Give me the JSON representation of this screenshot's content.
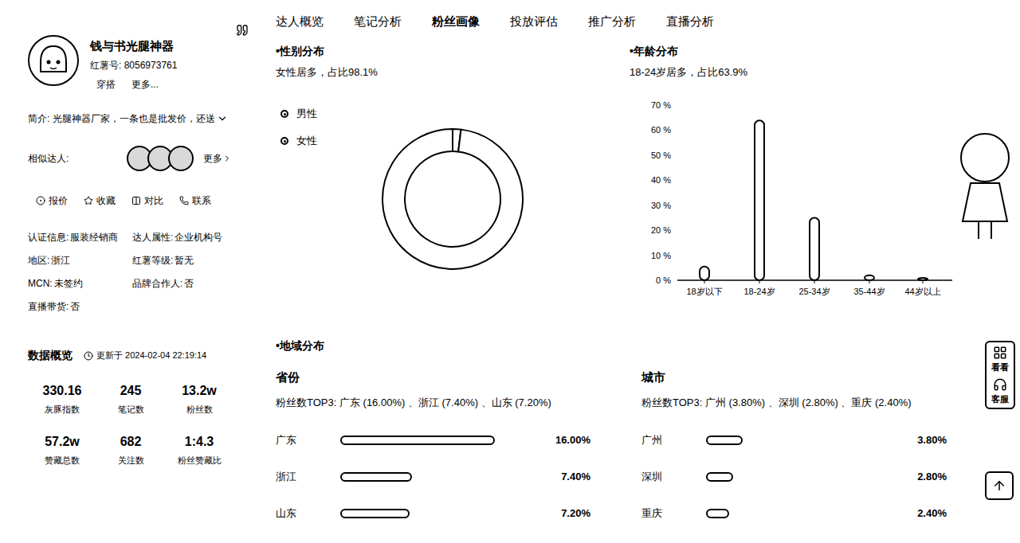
{
  "profile": {
    "name": "钱与书光腿神器",
    "red_id": "红薯号: 8056973761",
    "tags": [
      "穿搭",
      "更多..."
    ],
    "intro": "简介: 光腿神器厂家，一条也是批发价，还送",
    "similar_label": "相似达人:",
    "similar_more": "更多"
  },
  "actions": [
    {
      "label": "报价"
    },
    {
      "label": "收藏"
    },
    {
      "label": "对比"
    },
    {
      "label": "联系"
    }
  ],
  "info": [
    {
      "label": "认证信息:",
      "value": "服装经销商"
    },
    {
      "label": "达人属性:",
      "value": "企业机构号"
    },
    {
      "label": "地区:",
      "value": "浙江"
    },
    {
      "label": "红薯等级:",
      "value": "暂无"
    },
    {
      "label": "MCN:",
      "value": "未签约"
    },
    {
      "label": "品牌合作人:",
      "value": "否"
    },
    {
      "label": "直播带货:",
      "value": "否"
    }
  ],
  "overview": {
    "title": "数据概览",
    "updated": "更新于 2024-02-04 22:19:14",
    "stats": [
      {
        "value": "330.16",
        "label": "灰豚指数"
      },
      {
        "value": "245",
        "label": "笔记数"
      },
      {
        "value": "13.2w",
        "label": "粉丝数"
      },
      {
        "value": "57.2w",
        "label": "赞藏总数"
      },
      {
        "value": "682",
        "label": "关注数"
      },
      {
        "value": "1:4.3",
        "label": "粉丝赞藏比"
      }
    ]
  },
  "tabs": [
    {
      "label": "达人概览",
      "selected": false
    },
    {
      "label": "笔记分析",
      "selected": false
    },
    {
      "label": "粉丝画像",
      "selected": true
    },
    {
      "label": "投放评估",
      "selected": false
    },
    {
      "label": "推广分析",
      "selected": false
    },
    {
      "label": "直播分析",
      "selected": false
    }
  ],
  "gender": {
    "title": "性别分布",
    "summary": "女性居多，占比98.1%",
    "series": [
      {
        "label": "男性",
        "share": 0.019
      },
      {
        "label": "女性",
        "share": 0.981
      }
    ]
  },
  "age": {
    "title": "年龄分布",
    "summary": "18-24岁居多，占比63.9%",
    "ticks": [
      "70 %",
      "60 %",
      "50 %",
      "40 %",
      "30 %",
      "20 %",
      "10 %",
      "0 %"
    ],
    "categories": [
      "18岁以下",
      "18-24岁",
      "25-34岁",
      "35-44岁",
      "44岁以上"
    ],
    "values": [
      5.5,
      63.9,
      25,
      2,
      0.5
    ]
  },
  "region": {
    "title": "地域分布",
    "province": {
      "title": "省份",
      "top3": "粉丝数TOP3: 广东 (16.00%) 、浙江 (7.40%) 、山东 (7.20%)",
      "rows": [
        {
          "name": "广东",
          "level": 1,
          "reading": "16.00%"
        },
        {
          "name": "浙江",
          "level": 0.4625,
          "reading": "7.40%"
        },
        {
          "name": "山东",
          "level": 0.45,
          "reading": "7.20%"
        }
      ]
    },
    "city": {
      "title": "城市",
      "top3": "粉丝数TOP3: 广州 (3.80%) 、深圳 (2.80%) 、重庆 (2.40%)",
      "rows": [
        {
          "name": "广州",
          "level": 0.2375,
          "reading": "3.80%"
        },
        {
          "name": "深圳",
          "level": 0.175,
          "reading": "2.80%"
        },
        {
          "name": "重庆",
          "level": 0.15,
          "reading": "2.40%"
        }
      ]
    }
  },
  "side_buttons": [
    {
      "label": "看看"
    },
    {
      "label": "客服"
    }
  ]
}
